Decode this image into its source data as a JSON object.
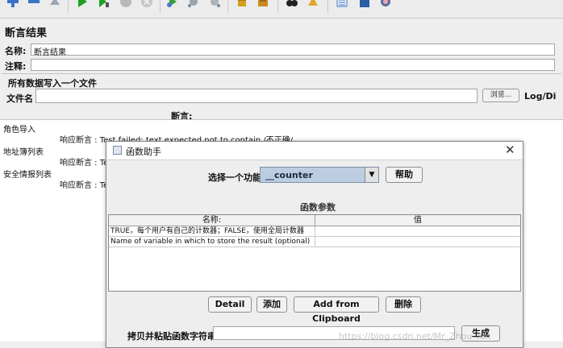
{
  "toolbar": {
    "buttons": [
      {
        "icon": "add-icon",
        "color": "#3a74c8"
      },
      {
        "icon": "remove-icon",
        "color": "#3a74c8"
      },
      {
        "icon": "clear-icon",
        "color": "#9aa6b5"
      },
      {
        "icon": "start-icon",
        "color": "#1ea023"
      },
      {
        "icon": "start-no-pause-icon",
        "color": "#1ea023"
      },
      {
        "icon": "stop-icon",
        "color": "#b9b9b9"
      },
      {
        "icon": "shutdown-icon",
        "color": "#b9b9b9"
      },
      {
        "icon": "remote-start-icon",
        "color": "#33a03a"
      },
      {
        "icon": "remote-stop-icon",
        "color": "#9aa4ad"
      },
      {
        "icon": "remote-shutdown-icon",
        "color": "#9aa4ad"
      },
      {
        "icon": "clear-all-icon",
        "color": "#d4a020"
      },
      {
        "icon": "clear-results-icon",
        "color": "#c88a1e"
      },
      {
        "icon": "search-icon",
        "color": "#222222"
      },
      {
        "icon": "reset-search-icon",
        "color": "#e0a82a"
      },
      {
        "icon": "function-helper-icon",
        "color": "#4a7cc6"
      },
      {
        "icon": "help-icon",
        "color": "#2c5ea8"
      },
      {
        "icon": "templates-icon",
        "color": "#5a6ea0"
      }
    ]
  },
  "panel": {
    "title": "断言结果",
    "name_label": "名称:",
    "name_value": "断言结果",
    "comment_label": "注释:",
    "group_title": "所有数据写入一个文件",
    "file_label": "文件名",
    "browse_label": "浏览...",
    "log_label": "Log/Di",
    "assertions_header": "断言:"
  },
  "tree": [
    {
      "label": "角色导入",
      "sub": "响应断言 : Test failed: text expected not to contain /不正确/"
    },
    {
      "label": "地址簿列表",
      "sub": "响应断言 : Tes"
    },
    {
      "label": "安全情报列表",
      "sub": "响应断言 : Tes"
    }
  ],
  "dialog": {
    "title": "函数助手",
    "close_glyph": "✕",
    "function_label": "选择一个功能",
    "function_value": "__counter",
    "help_label": "帮助",
    "params_title": "函数参数",
    "table": {
      "col_name": "名称:",
      "col_value": "值",
      "rows": [
        {
          "name": "TRUE，每个用户有自己的计数器；FALSE，使用全局计数器",
          "value": ""
        },
        {
          "name": "Name of variable in which to store the result (optional)",
          "value": ""
        }
      ]
    },
    "buttons": {
      "detail": "Detail",
      "add": "添加",
      "add_clipboard": "Add from Clipboard",
      "delete": "删除"
    },
    "copy_label": "拷贝并粘贴函数字符串",
    "copy_value": "",
    "generate_label": "生成"
  },
  "watermark": "https://blog.csdn.net/Mr_Zhou_Xin"
}
